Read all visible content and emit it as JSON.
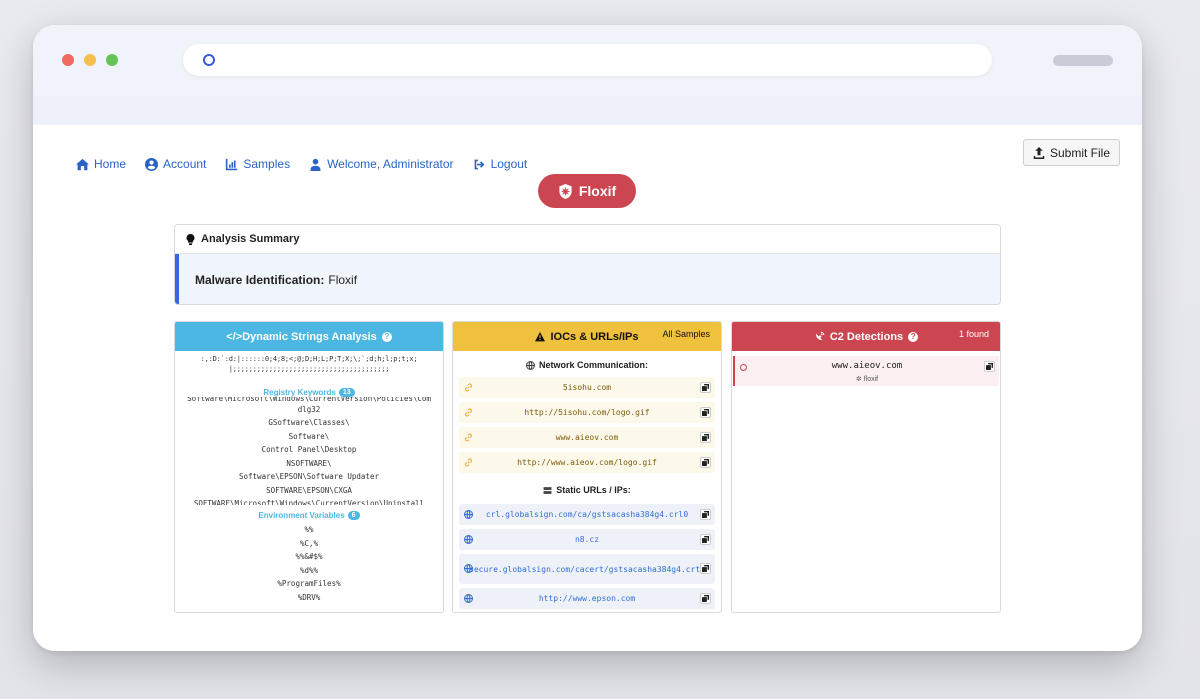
{
  "nav": {
    "home": "Home",
    "account": "Account",
    "samples": "Samples",
    "welcome": "Welcome, Administrator",
    "logout": "Logout"
  },
  "submit_label": "Submit File",
  "family_name": "Floxif",
  "summary": {
    "title": "Analysis Summary",
    "label": "Malware Identification:",
    "value": "Floxif"
  },
  "strings_card": {
    "title": "</>Dynamic Strings Analysis",
    "top_lines": [
      ":,:D:`:d:|::::::0;4;8;<;@;D;H;L;P;T;X;\\;`;d;h;l;p;t;x;",
      "|;;;;;;;;;;;;;;;;;;;;;;;;;;;;;;;;;;;;;;;"
    ],
    "registry_title": "Registry Keywords",
    "registry_count": "13",
    "registry_items": [
      "Software\\Microsoft\\Windows\\CurrentVersion\\Policies\\Com",
      "dlg32",
      "GSoftware\\Classes\\",
      "Software\\",
      "Control Panel\\Desktop",
      "NSOFTWARE\\",
      "Software\\EPSON\\Software Updater",
      "SOFTWARE\\EPSON\\CXGA",
      "SOFTWARE\\Microsoft\\Windows\\CurrentVersion\\Uninstall"
    ],
    "env_title": "Environment Variables",
    "env_count": "6",
    "env_items": [
      "%%",
      "%C,%",
      "%%&#$%",
      "%d%%",
      "%ProgramFiles%",
      "%DRV%"
    ]
  },
  "ioc_card": {
    "title": "IOCs & URLs/IPs",
    "note": "All Samples",
    "network_title": "Network Communication:",
    "network_items": [
      "5isohu.com",
      "http://5isohu.com/logo.gif",
      "www.aieov.com",
      "http://www.aieov.com/logo.gif"
    ],
    "static_title": "Static URLs / IPs:",
    "static_items": [
      "crl.globalsign.com/ca/gstsacasha384g4.crl0",
      "n8.cz",
      "secure.globalsign.com/cacert/gstsacasha384g4.crt0",
      "http://www.epson.com"
    ]
  },
  "c2_card": {
    "title": "C2 Detections",
    "note": "1 found",
    "detections": [
      {
        "domain": "www.aieov.com",
        "family": "floxif"
      }
    ]
  },
  "colors": {
    "accent_blue": "#2a63c6",
    "strings_header": "#4cb7e2",
    "ioc_header": "#f0c13c",
    "c2_header": "#cc4651"
  }
}
